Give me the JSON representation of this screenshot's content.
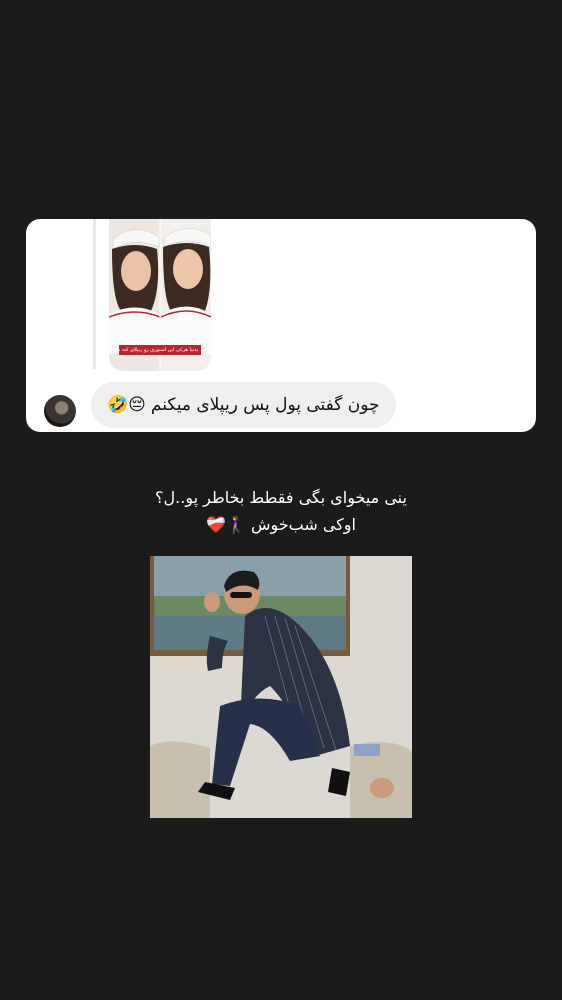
{
  "background_color": "#1b1b1b",
  "dm_screenshot": {
    "story_caption": "بدنیا هرکی این استوری رو ریپلای کنه پول ریزه از زیبی بهش میرسه",
    "message": {
      "text": "چون گفتی پول پس ریپلای میکنم",
      "emojis": "😔🤣"
    },
    "avatar_icon": "profile-avatar"
  },
  "story_text": {
    "line1": "ینی میخوای بگی فقطط بخاطر پو..ل؟",
    "line2": "اوکی شب‌خوش",
    "line2_emojis": "🚶‍♀️❤️‍🩹"
  },
  "photo": {
    "subject": "man in pinstripe suit and sunglasses posing on armchair"
  }
}
